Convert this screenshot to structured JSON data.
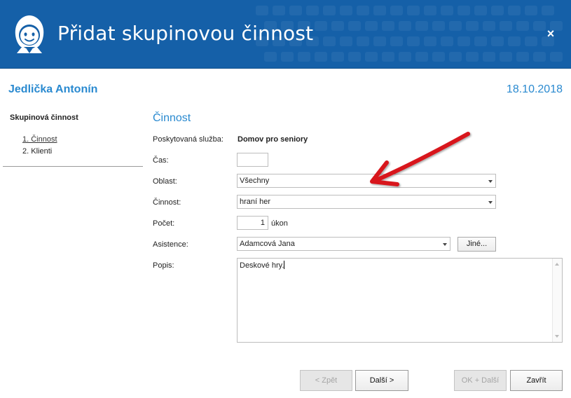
{
  "header": {
    "title": "Přidat skupinovou činnost",
    "close_symbol": "×",
    "logo_icon": "nurse-face-icon",
    "background_color": "#1560a8"
  },
  "client": {
    "name": "Jedlička Antonín",
    "date": "18.10.2018"
  },
  "sidebar": {
    "title": "Skupinová činnost",
    "steps": [
      {
        "label": "1. Činnost",
        "active": true
      },
      {
        "label": "2. Klienti",
        "active": false
      }
    ]
  },
  "form": {
    "section_title": "Činnost",
    "service": {
      "label": "Poskytovaná služba:",
      "value": "Domov pro seniory"
    },
    "time": {
      "label": "Čas:",
      "value": ""
    },
    "area": {
      "label": "Oblast:",
      "value": "Všechny"
    },
    "activity": {
      "label": "Činnost:",
      "value": "hraní her"
    },
    "count": {
      "label": "Počet:",
      "value": "1",
      "unit": "úkon"
    },
    "assistance": {
      "label": "Asistence:",
      "value": "Adamcová Jana",
      "other_button": "Jiné..."
    },
    "description": {
      "label": "Popis:",
      "value": "Deskové hry."
    }
  },
  "buttons": {
    "back": {
      "label": "< Zpět",
      "enabled": false
    },
    "next": {
      "label": "Další >",
      "enabled": true
    },
    "ok_next": {
      "label": "OK + Další",
      "enabled": false
    },
    "close": {
      "label": "Zavřít",
      "enabled": true
    }
  },
  "annotation": {
    "arrow_color": "#d8141c"
  },
  "colors": {
    "accent": "#2a8ad0"
  }
}
